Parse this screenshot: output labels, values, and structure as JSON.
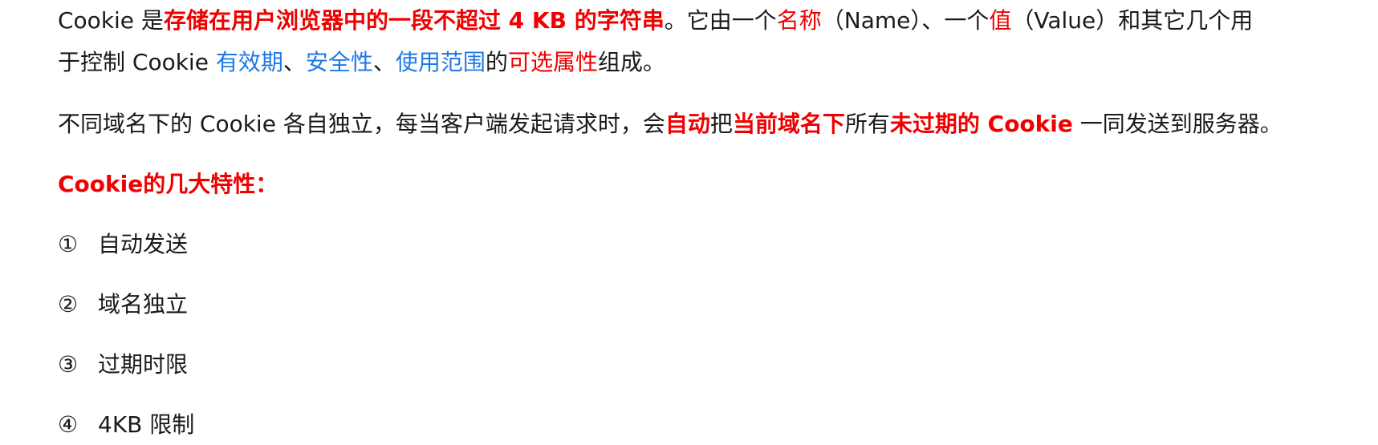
{
  "paragraph1": {
    "line1": {
      "t1": "Cookie 是",
      "t2": "存储在用户浏览器中的一段不超过 4 KB 的字符串",
      "t3": "。它由一个",
      "t4": "名称",
      "t5": "（Name）、一个",
      "t6": "值",
      "t7": "（Value）和其它几个用"
    },
    "line2": {
      "t1": "于控制 Cookie ",
      "t2": "有效期",
      "t3": "、",
      "t4": "安全性",
      "t5": "、",
      "t6": "使用范围",
      "t7": "的",
      "t8": "可选属性",
      "t9": "组成。"
    }
  },
  "paragraph2": {
    "t1": "不同域名下的 Cookie 各自独立，每当客户端发起请求时，会",
    "t2": "自动",
    "t3": "把",
    "t4": "当前域名下",
    "t5": "所有",
    "t6": "未过期的 Cookie",
    "t7": " 一同发送到服务器。"
  },
  "heading": "Cookie的几大特性：",
  "features": [
    {
      "marker": "①",
      "text": "自动发送"
    },
    {
      "marker": "②",
      "text": "域名独立"
    },
    {
      "marker": "③",
      "text": "过期时限"
    },
    {
      "marker": "④",
      "text": "4KB 限制"
    }
  ],
  "colors": {
    "emphasis_red": "#f00000",
    "link_blue": "#1e78e6",
    "body_text": "#1a1a1a"
  }
}
